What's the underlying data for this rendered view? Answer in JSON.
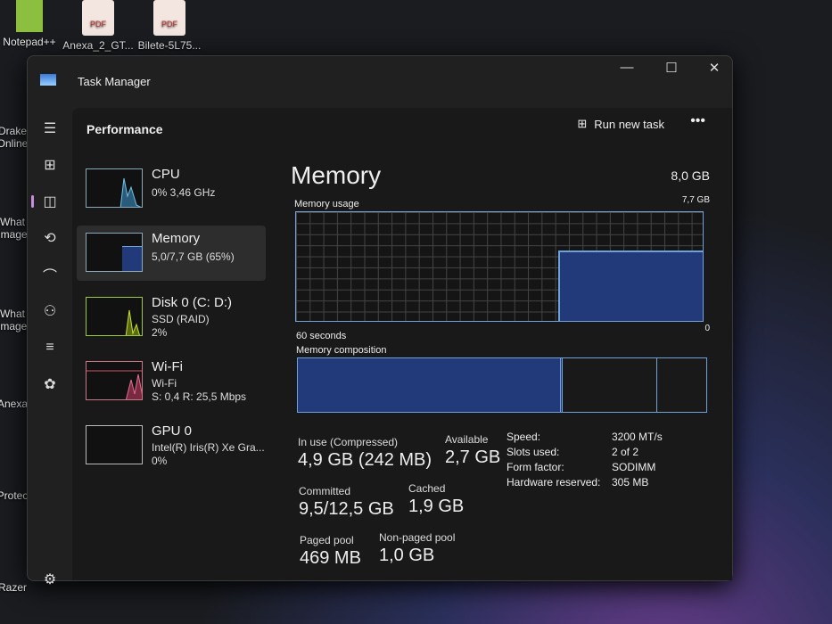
{
  "desktop": {
    "icons": [
      "Notepad++",
      "Anexa_2_GT...",
      "Bilete-5L75...",
      "Drake Online",
      "What Image",
      "What image",
      "Anexa",
      "Protec",
      "Razer"
    ],
    "pdf_label": "PDF"
  },
  "window": {
    "title": "Task Manager",
    "minimize": "—",
    "maximize": "☐",
    "close": "✕"
  },
  "header": {
    "title": "Performance",
    "run_new_task": "Run new task",
    "more": "•••"
  },
  "nav": [
    {
      "icon": "hamburger-icon",
      "glyph": "☰"
    },
    {
      "icon": "processes-icon",
      "glyph": "⊞"
    },
    {
      "icon": "performance-icon",
      "glyph": "◫"
    },
    {
      "icon": "app-history-icon",
      "glyph": "⟲"
    },
    {
      "icon": "startup-icon",
      "glyph": "⌒"
    },
    {
      "icon": "users-icon",
      "glyph": "⚇"
    },
    {
      "icon": "details-icon",
      "glyph": "≡"
    },
    {
      "icon": "services-icon",
      "glyph": "✿"
    },
    {
      "icon": "settings-icon",
      "glyph": "⚙"
    }
  ],
  "devices": [
    {
      "name": "CPU",
      "line1": "0% 3,46 GHz",
      "line2": ""
    },
    {
      "name": "Memory",
      "line1": "5,0/7,7 GB (65%)",
      "line2": ""
    },
    {
      "name": "Disk 0 (C: D:)",
      "line1": "SSD (RAID)",
      "line2": "2%"
    },
    {
      "name": "Wi-Fi",
      "line1": "Wi-Fi",
      "line2": "S: 0,4 R: 25,5 Mbps"
    },
    {
      "name": "GPU 0",
      "line1": "Intel(R) Iris(R) Xe Gra...",
      "line2": "0%"
    }
  ],
  "memory": {
    "title": "Memory",
    "total": "8,0 GB",
    "usage_label": "Memory usage",
    "usage_max": "7,7 GB",
    "time_label": "60 seconds",
    "min_label": "0",
    "composition_label": "Memory composition",
    "stats": {
      "in_use_label": "In use (Compressed)",
      "in_use": "4,9 GB (242 MB)",
      "available_label": "Available",
      "available": "2,7 GB",
      "committed_label": "Committed",
      "committed": "9,5/12,5 GB",
      "cached_label": "Cached",
      "cached": "1,9 GB",
      "paged_label": "Paged pool",
      "paged": "469 MB",
      "nonpaged_label": "Non-paged pool",
      "nonpaged": "1,0 GB"
    },
    "specs": [
      {
        "k": "Speed:",
        "v": "3200 MT/s"
      },
      {
        "k": "Slots used:",
        "v": "2 of 2"
      },
      {
        "k": "Form factor:",
        "v": "SODIMM"
      },
      {
        "k": "Hardware reserved:",
        "v": "305 MB"
      }
    ],
    "usage_percent": 65
  }
}
